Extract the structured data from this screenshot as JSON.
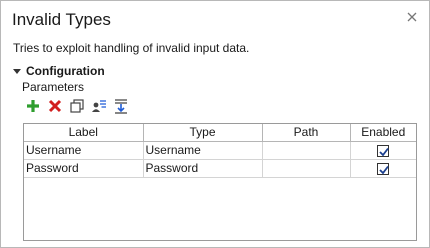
{
  "panel": {
    "title": "Invalid Types",
    "description": "Tries to exploit handling of invalid input data.",
    "close_icon": "close-icon"
  },
  "configuration": {
    "section_label": "Configuration",
    "parameters_label": "Parameters",
    "toolbar": [
      {
        "icon": "add-icon",
        "color": "#2e9e2e"
      },
      {
        "icon": "delete-icon",
        "color": "#d21f1f"
      },
      {
        "icon": "duplicate-icon",
        "color": "#444444"
      },
      {
        "icon": "user-list-icon",
        "color": "#444444"
      },
      {
        "icon": "move-down-icon",
        "color": "#1e5bd6"
      }
    ]
  },
  "table": {
    "columns": [
      "Label",
      "Type",
      "Path",
      "Enabled"
    ],
    "rows": [
      {
        "label": "Username",
        "type": "Username",
        "path": "",
        "enabled": true
      },
      {
        "label": "Password",
        "type": "Password",
        "path": "",
        "enabled": true
      }
    ]
  }
}
